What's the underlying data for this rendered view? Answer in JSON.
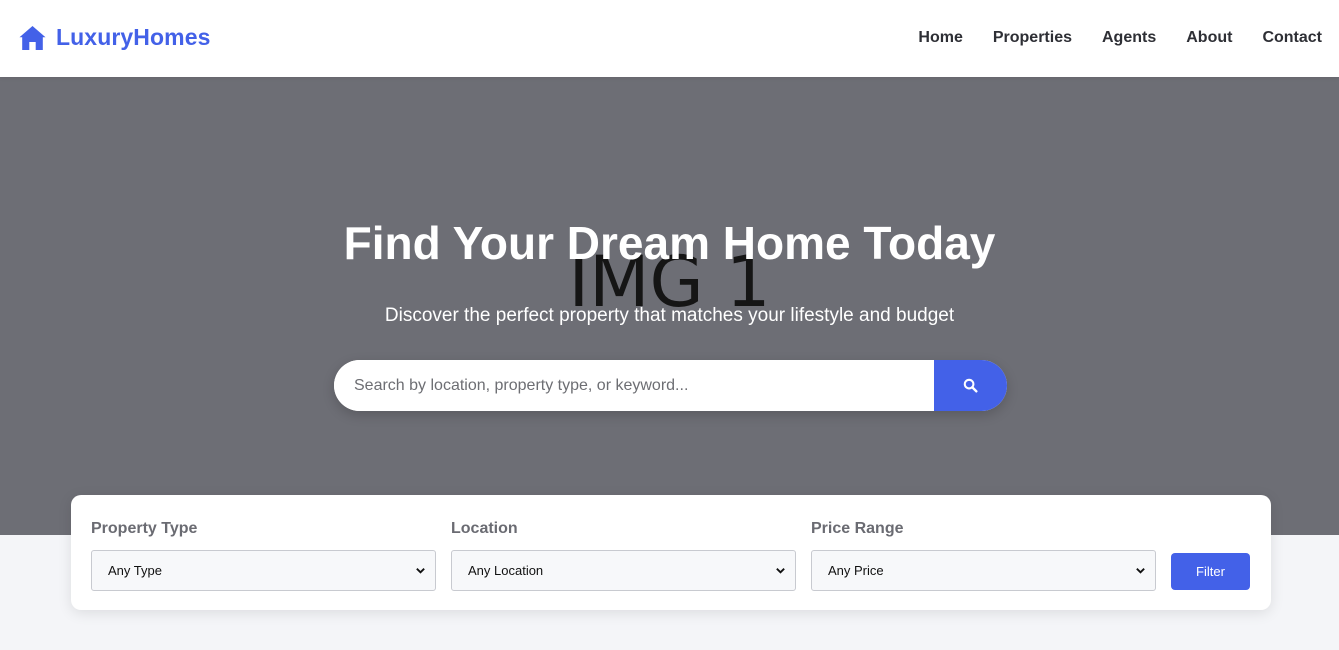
{
  "brand": {
    "name": "LuxuryHomes",
    "icon": "home-icon"
  },
  "nav": {
    "items": [
      "Home",
      "Properties",
      "Agents",
      "About",
      "Contact"
    ]
  },
  "hero": {
    "image_placeholder": "IMG 1",
    "title": "Find Your Dream Home Today",
    "subtitle": "Discover the perfect property that matches your lifestyle and budget",
    "search": {
      "placeholder": "Search by location, property type, or keyword...",
      "button_icon": "search-icon"
    }
  },
  "filters": {
    "groups": [
      {
        "label": "Property Type",
        "selected": "Any Type"
      },
      {
        "label": "Location",
        "selected": "Any Location"
      },
      {
        "label": "Price Range",
        "selected": "Any Price"
      }
    ],
    "button_label": "Filter"
  },
  "colors": {
    "accent": "#4361e8",
    "hero_bg": "#6d6e75",
    "page_bg": "#f4f5f8"
  }
}
